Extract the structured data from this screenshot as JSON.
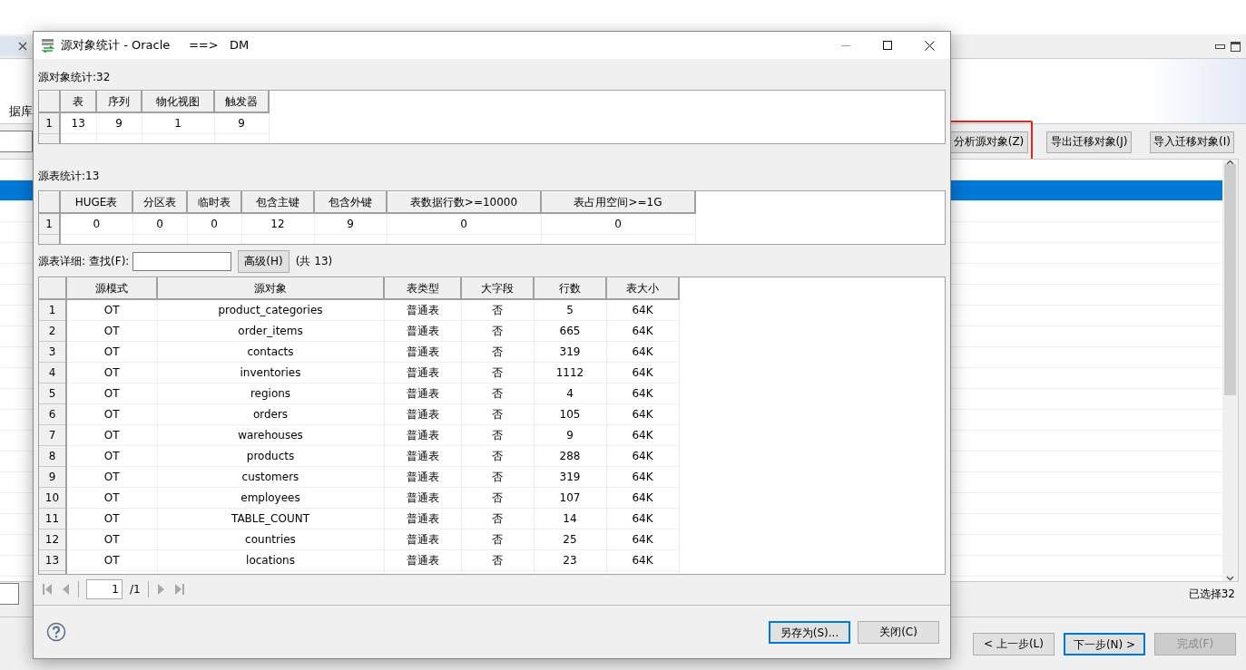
{
  "wizard": {
    "header_text": "据库",
    "toolbar_buttons": [
      {
        "label": "分析源对象(Z)",
        "highlighted": true
      },
      {
        "label": "导出迁移对象(J)",
        "highlighted": false
      },
      {
        "label": "导入迁移对象(I)",
        "highlighted": false
      }
    ],
    "list_rows": [
      {
        "selected": false
      },
      {
        "selected": true
      },
      {
        "selected": false
      },
      {
        "selected": false
      },
      {
        "selected": false
      },
      {
        "selected": false
      },
      {
        "selected": false
      },
      {
        "selected": false
      },
      {
        "selected": false
      },
      {
        "selected": false
      },
      {
        "selected": false
      },
      {
        "selected": false
      },
      {
        "selected": false
      },
      {
        "selected": false
      },
      {
        "selected": false
      },
      {
        "selected": false
      },
      {
        "selected": false
      },
      {
        "selected": false
      },
      {
        "selected": false
      },
      {
        "selected": false
      }
    ],
    "selection_status": "已选择32",
    "nav_buttons": [
      {
        "label": "< 上一步(L)",
        "default": false,
        "disabled": false
      },
      {
        "label": "下一步(N) >",
        "default": true,
        "disabled": false
      },
      {
        "label": "完成(F)",
        "default": false,
        "disabled": true
      }
    ]
  },
  "dialog": {
    "title": "源对象统计 - Oracle     ==>   DM",
    "object_stats": {
      "label": "源对象统计:32",
      "columns": [
        "表",
        "序列",
        "物化视图",
        "触发器"
      ],
      "rows": [
        {
          "number": "1",
          "cells": [
            "13",
            "9",
            "1",
            "9"
          ]
        }
      ]
    },
    "table_stats": {
      "label": "源表统计:13",
      "columns": [
        "HUGE表",
        "分区表",
        "临时表",
        "包含主键",
        "包含外键",
        "表数据行数>=10000",
        "表占用空间>=1G"
      ],
      "rows": [
        {
          "number": "1",
          "cells": [
            "0",
            "0",
            "0",
            "12",
            "9",
            "0",
            "0"
          ]
        }
      ]
    },
    "details": {
      "label": "源表详细:",
      "search_label": "查找(F):",
      "advanced_button": "高级(H)",
      "count": "(共 13)",
      "columns": [
        "源模式",
        "源对象",
        "表类型",
        "大字段",
        "行数",
        "表大小"
      ],
      "rows": [
        {
          "number": "1",
          "cells": [
            "OT",
            "product_categories",
            "普通表",
            "否",
            "5",
            "64K"
          ]
        },
        {
          "number": "2",
          "cells": [
            "OT",
            "order_items",
            "普通表",
            "否",
            "665",
            "64K"
          ]
        },
        {
          "number": "3",
          "cells": [
            "OT",
            "contacts",
            "普通表",
            "否",
            "319",
            "64K"
          ]
        },
        {
          "number": "4",
          "cells": [
            "OT",
            "inventories",
            "普通表",
            "否",
            "1112",
            "64K"
          ]
        },
        {
          "number": "5",
          "cells": [
            "OT",
            "regions",
            "普通表",
            "否",
            "4",
            "64K"
          ]
        },
        {
          "number": "6",
          "cells": [
            "OT",
            "orders",
            "普通表",
            "否",
            "105",
            "64K"
          ]
        },
        {
          "number": "7",
          "cells": [
            "OT",
            "warehouses",
            "普通表",
            "否",
            "9",
            "64K"
          ]
        },
        {
          "number": "8",
          "cells": [
            "OT",
            "products",
            "普通表",
            "否",
            "288",
            "64K"
          ]
        },
        {
          "number": "9",
          "cells": [
            "OT",
            "customers",
            "普通表",
            "否",
            "319",
            "64K"
          ]
        },
        {
          "number": "10",
          "cells": [
            "OT",
            "employees",
            "普通表",
            "否",
            "107",
            "64K"
          ]
        },
        {
          "number": "11",
          "cells": [
            "OT",
            "TABLE_COUNT",
            "普通表",
            "否",
            "14",
            "64K"
          ]
        },
        {
          "number": "12",
          "cells": [
            "OT",
            "countries",
            "普通表",
            "否",
            "25",
            "64K"
          ]
        },
        {
          "number": "13",
          "cells": [
            "OT",
            "locations",
            "普通表",
            "否",
            "23",
            "64K"
          ]
        }
      ]
    },
    "pager": {
      "page": "1",
      "total": "/1"
    },
    "buttons": [
      {
        "label": "另存为(S)...",
        "default": true
      },
      {
        "label": "关闭(C)",
        "default": false
      }
    ]
  }
}
